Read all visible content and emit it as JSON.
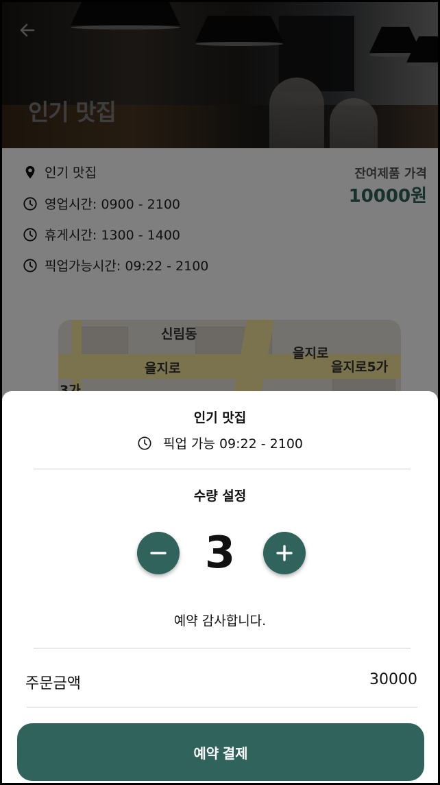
{
  "header": {
    "title": "인기 맛집",
    "back_icon": "arrow-left-icon"
  },
  "info": {
    "store_name": "인기 맛집",
    "hours": "영업시간: 0900 - 2100",
    "break_time": "휴게시간: 1300 - 1400",
    "pickup_time": "픽업가능시간: 09:22 - 2100",
    "price_label": "잔여제품 가격",
    "price_value": "10000원"
  },
  "map": {
    "labels": [
      "신림동",
      "을지로",
      "을지로",
      "을지로5가",
      "3가"
    ]
  },
  "sheet": {
    "store_name": "인기 맛집",
    "pickup_text": "픽업 가능 09:22 - 2100",
    "quantity_title": "수량 설정",
    "quantity": "3",
    "thanks": "예약 감사합니다.",
    "amount_label": "주문금액",
    "amount_value": "30000",
    "pay_button": "예약 결제"
  },
  "colors": {
    "accent": "#2f635b"
  }
}
